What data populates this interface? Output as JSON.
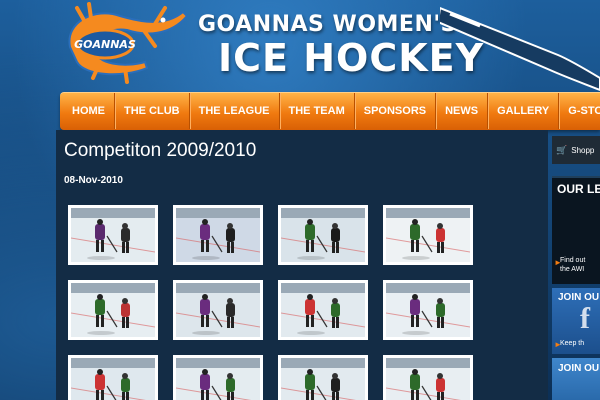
{
  "header": {
    "logo_text": "GOANNAS",
    "title_line1": "GOANNAS WOMEN'S",
    "title_line2": "ICE HOCKEY"
  },
  "nav": {
    "items": [
      "HOME",
      "THE CLUB",
      "THE LEAGUE",
      "THE TEAM",
      "SPONSORS",
      "NEWS",
      "GALLERY",
      "G-STORE"
    ]
  },
  "content": {
    "title": "Competiton 2009/2010",
    "date": "08-Nov-2010",
    "gallery_rows": 3,
    "gallery_cols": 4,
    "thumbnail_count": 12
  },
  "sidebar": {
    "shop_label": "Shopp",
    "league_heading": "OUR LEA",
    "league_text_1": "Find out",
    "league_text_2": "the AWI",
    "fb_heading": "JOIN OU",
    "fb_text": "Keep th",
    "join2_heading": "JOIN OU"
  },
  "colors": {
    "nav_orange": "#f07a10",
    "content_bg": "#132c45",
    "accent_orange": "#f27c12",
    "facebook_blue": "#2e6fb8"
  }
}
